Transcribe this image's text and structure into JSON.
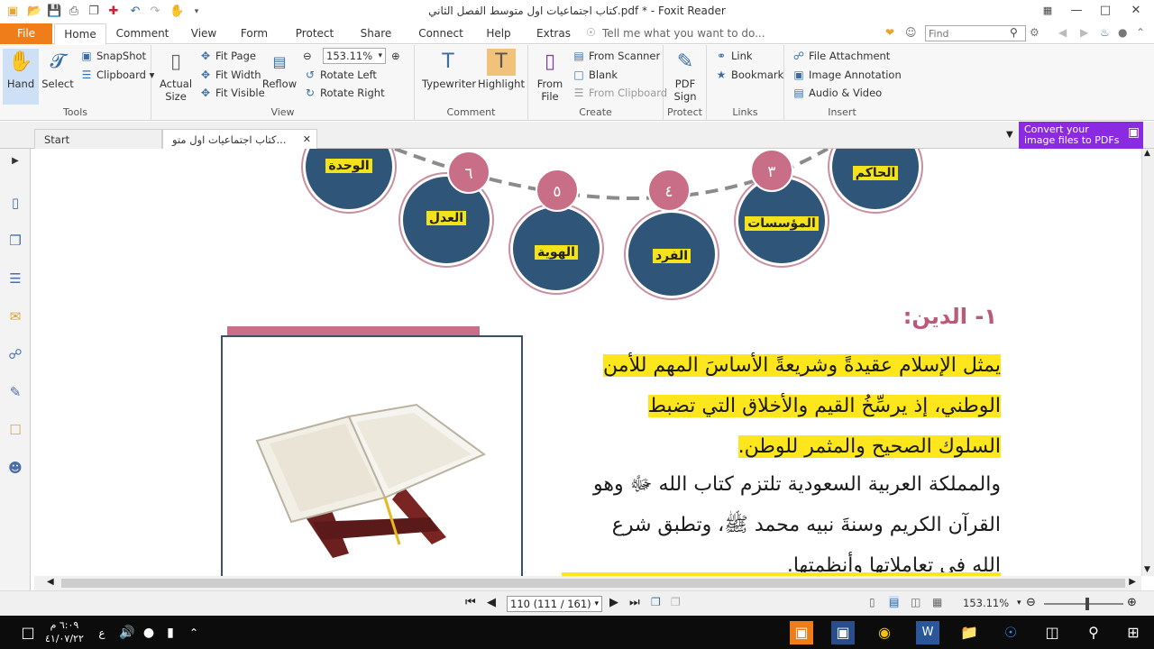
{
  "window": {
    "title": "كتاب اجتماعيات اول متوسط الفصل الثاني.pdf * - Foxit Reader"
  },
  "menu": {
    "file": "File",
    "tabs": [
      "Home",
      "Comment",
      "View",
      "Form",
      "Protect",
      "Share",
      "Connect",
      "Help",
      "Extras"
    ],
    "tell_me": "Tell me what you want to do...",
    "find_placeholder": "Find"
  },
  "ribbon": {
    "tools": {
      "label": "Tools",
      "hand": "Hand",
      "select": "Select",
      "snapshot": "SnapShot",
      "clipboard": "Clipboard"
    },
    "view": {
      "label": "View",
      "actual_size": "Actual Size",
      "fit_page": "Fit Page",
      "fit_width": "Fit Width",
      "fit_visible": "Fit Visible",
      "reflow": "Reflow",
      "zoom_value": "153.11%",
      "rotate_left": "Rotate Left",
      "rotate_right": "Rotate Right"
    },
    "comment": {
      "label": "Comment",
      "typewriter": "Typewriter",
      "highlight": "Highlight"
    },
    "create": {
      "label": "Create",
      "from_file": "From File",
      "from_scanner": "From Scanner",
      "blank": "Blank",
      "from_clipboard": "From Clipboard"
    },
    "protect": {
      "label": "Protect",
      "pdf_sign": "PDF Sign"
    },
    "links": {
      "label": "Links",
      "link": "Link",
      "bookmark": "Bookmark"
    },
    "insert": {
      "label": "Insert",
      "file_attachment": "File Attachment",
      "image_annotation": "Image Annotation",
      "audio_video": "Audio & Video"
    }
  },
  "doc_tabs": {
    "start": "Start",
    "current": "كتاب اجتماعيات اول متو..."
  },
  "promo": {
    "line1": "Convert your",
    "line2": "image files to PDFs"
  },
  "page": {
    "circles": [
      {
        "label": "الوحدة"
      },
      {
        "label": "العدل",
        "num": "٦"
      },
      {
        "label": "الهوية",
        "num": "٥"
      },
      {
        "label": "الفرد",
        "num": "٤"
      },
      {
        "label": "المؤسسات",
        "num": "٣"
      },
      {
        "label": "الحاكم"
      }
    ],
    "heading": "١- الدين:",
    "para1_line1": "يمثل الإسلام عقيدةً وشريعةً الأساسَ المهم للأمن",
    "para1_line2": "الوطني، إذ يرسِّخُ القيم والأخلاق التي تضبط",
    "para1_line3": "السلوك الصحيح والمثمر للوطن.",
    "para2_line1": "والمملكة العربية السعودية تلتزم كتاب الله ﷻ وهو",
    "para2_line2": "القرآن الكريم وسنةَ نبيه محمد ﷺ، وتطبق شرع",
    "para2_line3": "الله في تعاملاتها وأنظمتها."
  },
  "navbar": {
    "page_value": "110 (111 / 161)",
    "zoom_value": "153.11%"
  },
  "taskbar": {
    "time": "٦:٠٩ م",
    "date": "٤١/٠٧/٢٢",
    "lang": "ع"
  }
}
